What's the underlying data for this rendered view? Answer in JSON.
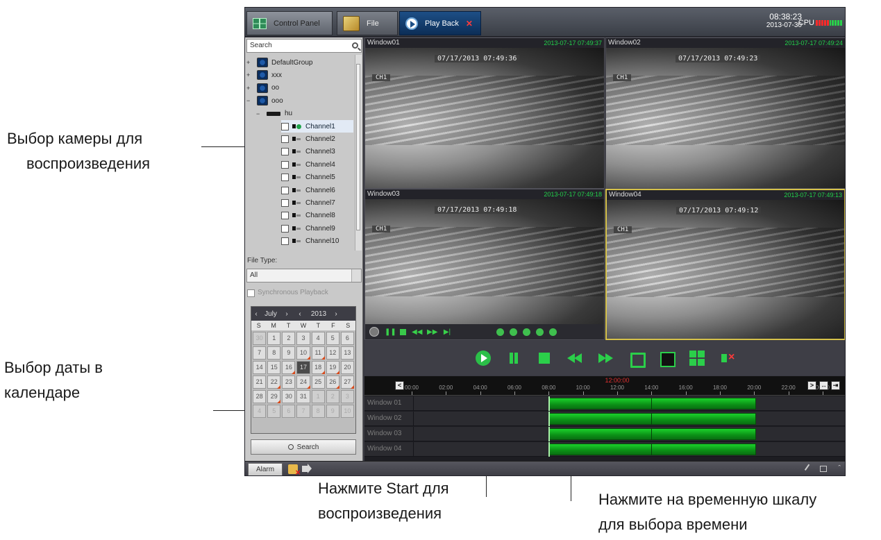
{
  "annotations": {
    "camera_select": [
      "Выбор камеры для",
      "воспроизведения"
    ],
    "date_select": [
      "Выбор даты в",
      "календаре"
    ],
    "start_play": [
      "Нажмите Start для",
      "воспроизведения"
    ],
    "timeline_select": [
      "Нажмите на временную шкалу",
      "для выбора времени"
    ]
  },
  "tabs": {
    "control_panel": "Control Panel",
    "file": "File",
    "playback": "Play Back"
  },
  "clock": {
    "time": "08:38:23",
    "date": "2013-07-30"
  },
  "cpu": {
    "label": "CPU",
    "bars_red": 5,
    "bars_total": 10
  },
  "search": {
    "placeholder": "Search"
  },
  "tree": {
    "groups": [
      {
        "label": "DefaultGroup",
        "toggle": "+"
      },
      {
        "label": "xxx",
        "toggle": "+"
      },
      {
        "label": "oo",
        "toggle": "+"
      },
      {
        "label": "ooo",
        "toggle": "−"
      }
    ],
    "device": {
      "label": "hu",
      "toggle": "−"
    },
    "channels": [
      "Channel1",
      "Channel2",
      "Channel3",
      "Channel4",
      "Channel5",
      "Channel6",
      "Channel7",
      "Channel8",
      "Channel9",
      "Channel10"
    ]
  },
  "file_type": {
    "label": "File Type:",
    "value": "All"
  },
  "sync_playback": {
    "label": "Synchronous Playback",
    "checked": false
  },
  "calendar": {
    "month": "July",
    "year": "2013",
    "weekdays": [
      "S",
      "M",
      "T",
      "W",
      "T",
      "F",
      "S"
    ],
    "weeks": [
      [
        "30",
        "1",
        "2",
        "3",
        "4",
        "5",
        "6"
      ],
      [
        "7",
        "8",
        "9",
        "10",
        "11",
        "12",
        "13"
      ],
      [
        "14",
        "15",
        "16",
        "17",
        "18",
        "19",
        "20"
      ],
      [
        "21",
        "22",
        "23",
        "24",
        "25",
        "26",
        "27"
      ],
      [
        "28",
        "29",
        "30",
        "31",
        "1",
        "2",
        "3"
      ],
      [
        "4",
        "5",
        "6",
        "7",
        "8",
        "9",
        "10"
      ]
    ],
    "selected_day": "17"
  },
  "search_button": "Search",
  "windows": [
    {
      "title": "Window01",
      "timestamp": "2013-07-17 07:49:37",
      "osd_time": "07/17/2013 07:49:36",
      "channel": "CH1"
    },
    {
      "title": "Window02",
      "timestamp": "2013-07-17 07:49:24",
      "osd_time": "07/17/2013 07:49:23",
      "channel": "CH1"
    },
    {
      "title": "Window03",
      "timestamp": "2013-07-17 07:49:18",
      "osd_time": "07/17/2013 07:49:18",
      "channel": "CH1"
    },
    {
      "title": "Window04",
      "timestamp": "2013-07-17 07:49:13",
      "osd_time": "07/17/2013 07:49:12",
      "channel": "CH1"
    }
  ],
  "timeline": {
    "cursor_time": "12:00:00",
    "ticks": [
      "00:00",
      "02:00",
      "04:00",
      "06:00",
      "08:00",
      "10:00",
      "12:00",
      "14:00",
      "16:00",
      "18:00",
      "20:00",
      "22:00",
      "00:00"
    ],
    "rows": [
      "Window 01",
      "Window 02",
      "Window 03",
      "Window 04"
    ],
    "recording_start_hour": 8.0,
    "recording_mid_hour": 14.0,
    "recording_end_hour": 20.1
  },
  "statusbar": {
    "alarm": "Alarm"
  },
  "colors": {
    "accent": "#1d4f86",
    "recording": "#1bd12b",
    "cursor": "#e03030"
  }
}
